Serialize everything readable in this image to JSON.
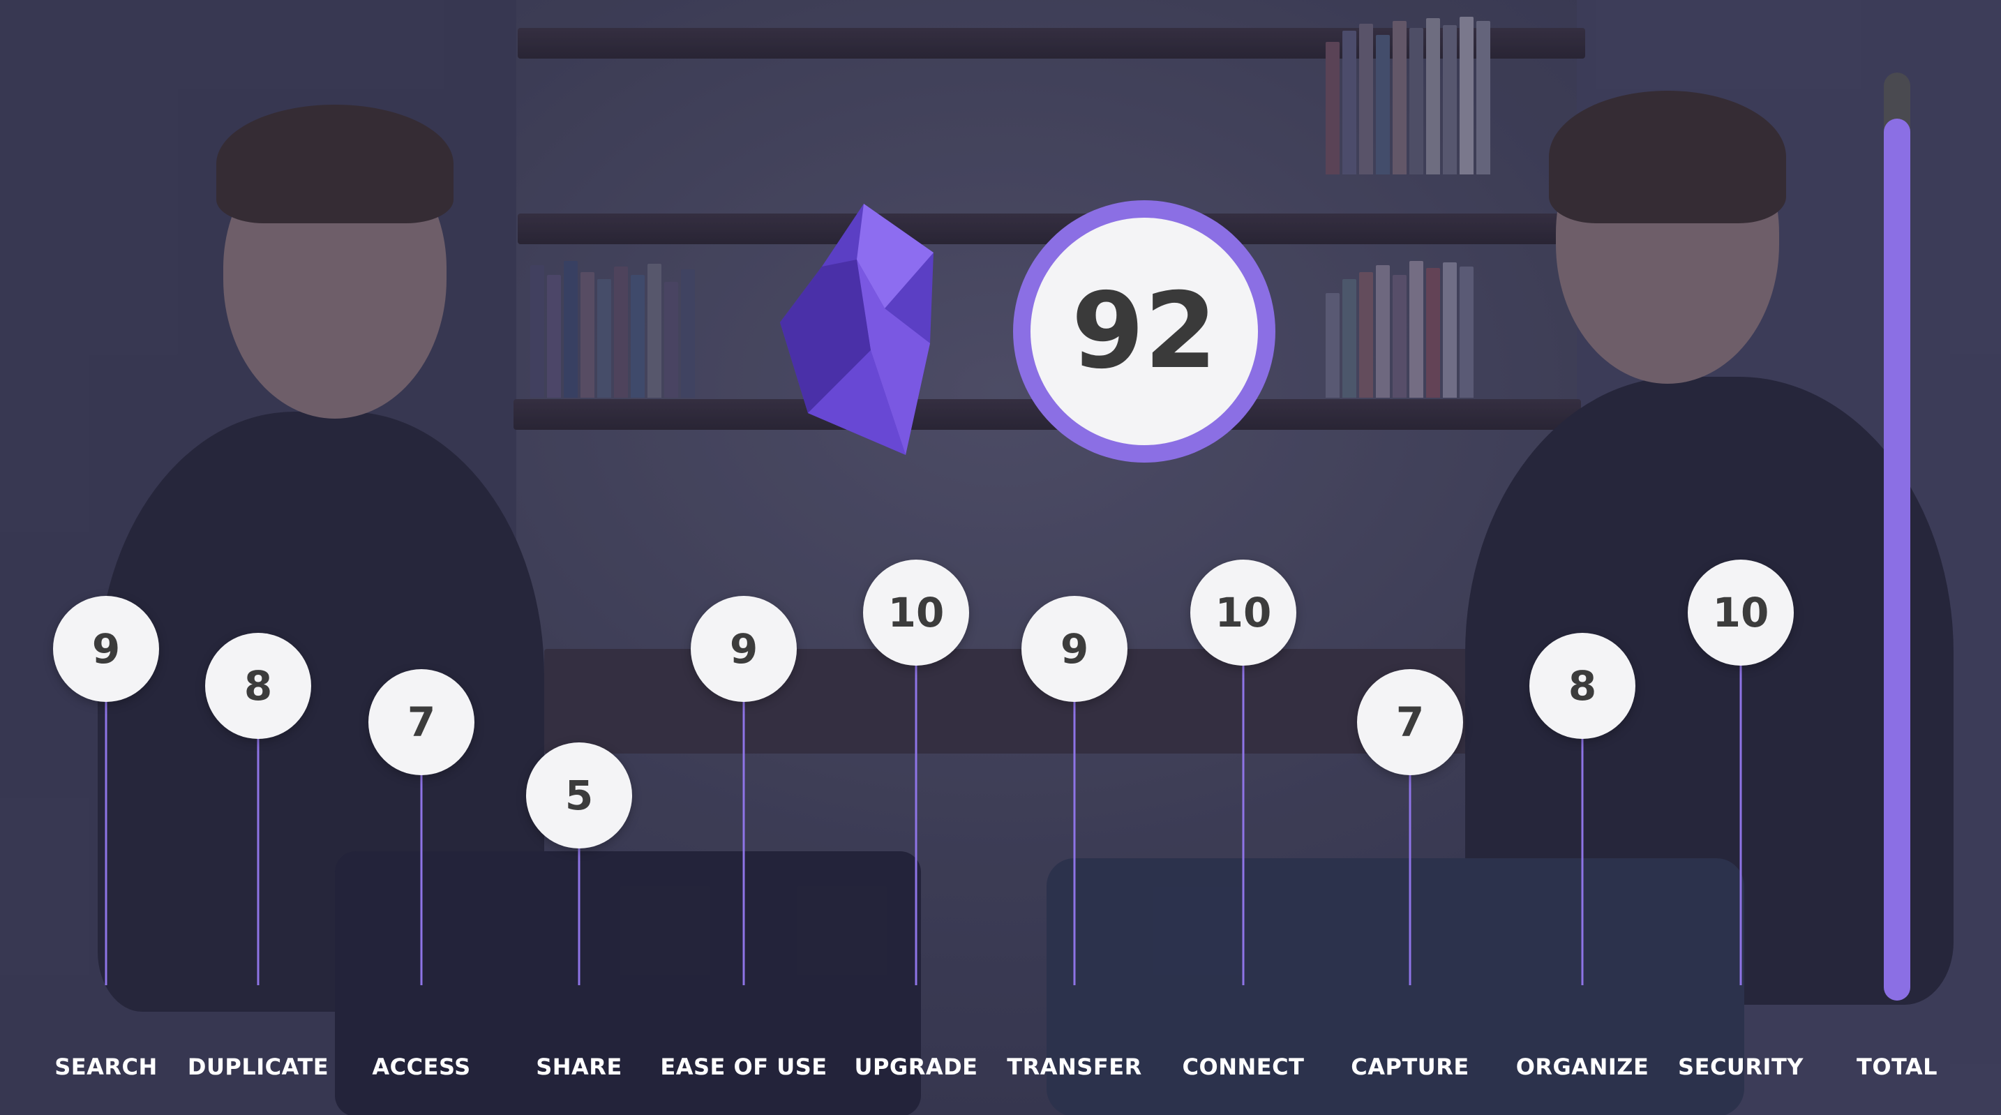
{
  "colors": {
    "accent": "#8b6fe4",
    "badge_bg": "#f4f4f6",
    "badge_text": "#3c3c3c",
    "label_text": "#ffffff",
    "track": "#4a4a50"
  },
  "logo": {
    "icon": "obsidian-crystal-icon"
  },
  "total": {
    "score": "92",
    "fill_fraction": 0.95
  },
  "chart_data": {
    "type": "bar",
    "categories": [
      "SEARCH",
      "DUPLICATE",
      "ACCESS",
      "SHARE",
      "EASE OF USE",
      "UPGRADE",
      "TRANSFER",
      "CONNECT",
      "CAPTURE",
      "ORGANIZE",
      "SECURITY"
    ],
    "values": [
      9,
      8,
      7,
      5,
      9,
      10,
      9,
      10,
      7,
      8,
      10
    ],
    "total_label": "TOTAL",
    "total_value": 92
  }
}
